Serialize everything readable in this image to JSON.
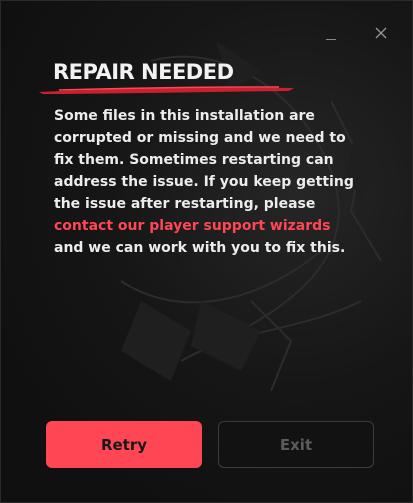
{
  "window": {
    "minimize_label": "minimize",
    "close_label": "close"
  },
  "dialog": {
    "heading": "REPAIR NEEDED",
    "message_before_link": "Some files in this installation are corrupted or missing and we need to fix them. Sometimes restarting can address the issue. If you keep getting the issue after restarting, please ",
    "link_text": "contact our player support wizards",
    "message_after_link": " and we can work with you to fix this."
  },
  "buttons": {
    "retry_label": "Retry",
    "exit_label": "Exit"
  },
  "colors": {
    "accent": "#ff4655",
    "background": "#111111",
    "text": "#ececec",
    "disabled_text": "#5b5b5b"
  },
  "icons": {
    "minimize": "minimize-icon",
    "close": "close-icon"
  }
}
